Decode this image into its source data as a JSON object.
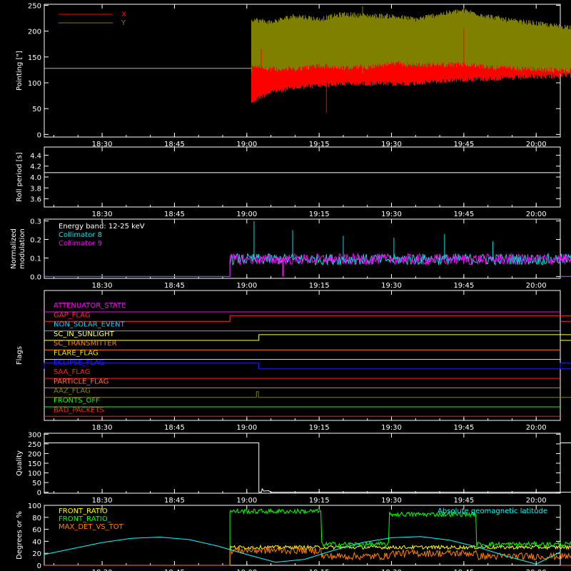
{
  "x_axis": {
    "tick_labels": [
      "18:30",
      "18:45",
      "19:00",
      "19:15",
      "19:30",
      "19:45",
      "20:00"
    ],
    "tick_minutes": [
      1110,
      1125,
      1140,
      1155,
      1170,
      1185,
      1200
    ],
    "range_minutes": [
      1098,
      1205
    ]
  },
  "chart_data": [
    {
      "type": "line",
      "id": "pointing",
      "ylabel": "Pointing [\"]",
      "ylim": [
        -5,
        252
      ],
      "yticks": [
        0,
        50,
        100,
        150,
        200,
        250
      ],
      "legend": [
        {
          "name": "X",
          "color": "#ff0000"
        },
        {
          "name": "Y",
          "color": "#808000"
        }
      ],
      "reference_line": {
        "y": 128,
        "color": "#b0b0b0"
      },
      "series": [
        {
          "name": "X",
          "color": "#ff0000",
          "x": [
            1141,
            1145,
            1150,
            1155,
            1160,
            1165,
            1170,
            1175,
            1180,
            1185,
            1190,
            1195,
            1200,
            1203,
            1207,
            1212,
            1217,
            1222,
            1227,
            1232,
            1237,
            1242
          ],
          "y_low": [
            68,
            88,
            95,
            100,
            103,
            104,
            103,
            104,
            108,
            112,
            113,
            114,
            117,
            118,
            119,
            120,
            121,
            121,
            122,
            122,
            122,
            122
          ],
          "y_high": [
            140,
            132,
            132,
            138,
            134,
            136,
            142,
            140,
            140,
            140,
            136,
            133,
            131,
            130,
            129,
            128,
            128,
            127,
            127,
            126,
            126,
            126
          ]
        },
        {
          "name": "Y",
          "color": "#808000",
          "x": [
            1141,
            1145,
            1150,
            1155,
            1160,
            1165,
            1170,
            1175,
            1180,
            1185,
            1190,
            1195,
            1200,
            1203,
            1207,
            1212,
            1217,
            1222,
            1227,
            1232,
            1237,
            1242
          ],
          "y_low": [
            140,
            132,
            132,
            138,
            134,
            136,
            142,
            140,
            140,
            140,
            136,
            133,
            131,
            130,
            129,
            128,
            128,
            127,
            127,
            126,
            126,
            126
          ],
          "y_high": [
            218,
            212,
            225,
            218,
            228,
            225,
            224,
            218,
            228,
            235,
            224,
            215,
            210,
            206,
            203,
            200,
            198,
            197,
            196,
            195,
            195,
            194
          ]
        }
      ],
      "spikes": [
        {
          "x": 1141.0,
          "y0": 120,
          "y1": 222,
          "color": "#808000"
        },
        {
          "x": 1143.0,
          "y0": 112,
          "y1": 165,
          "color": "#ff0000"
        },
        {
          "x": 1156.5,
          "y0": 42,
          "y1": 138,
          "color": "#ff0000"
        },
        {
          "x": 1164.0,
          "y0": 118,
          "y1": 248,
          "color": "#808000"
        },
        {
          "x": 1185.0,
          "y0": 128,
          "y1": 205,
          "color": "#ff0000"
        }
      ]
    },
    {
      "type": "line",
      "id": "roll",
      "ylabel": "Roll period [s]",
      "ylim": [
        3.45,
        4.55
      ],
      "yticks": [
        3.6,
        3.8,
        4.0,
        4.2,
        4.4
      ],
      "tick_labels": [
        "3.6",
        "3.8",
        "4.0",
        "4.2",
        "4.4"
      ],
      "series": [
        {
          "name": "",
          "color": "#ffffff",
          "x": [
            1098,
            1205
          ],
          "y": [
            4.08,
            4.08
          ]
        }
      ]
    },
    {
      "type": "line",
      "id": "modulation",
      "ylabel": "Normalized modulation",
      "ylim": [
        -0.01,
        0.31
      ],
      "yticks": [
        0.0,
        0.1,
        0.2,
        0.3
      ],
      "tick_labels": [
        "0.0",
        "0.1",
        "0.2",
        "0.3"
      ],
      "legend": [
        {
          "name": "Energy band: 12-25 keV",
          "color": "#ffffff"
        },
        {
          "name": "Collimator 8",
          "color": "#00e0e0"
        },
        {
          "name": "Collimator 9",
          "color": "#ff00ff"
        }
      ],
      "series": [
        {
          "name": "Collimator 8",
          "color": "#00e0e0",
          "x_range": [
            1136.5,
            1243.5
          ],
          "baseline": 0.09,
          "spread": 0.03
        },
        {
          "name": "Collimator 9",
          "color": "#ff00ff",
          "x_range": [
            1136.5,
            1243.5
          ],
          "baseline": 0.09,
          "spread": 0.03,
          "outside_value": 0.0,
          "dips": [
            {
              "x": 1147.5,
              "y": 0.0
            }
          ]
        }
      ],
      "peaks": [
        {
          "x": 1141.5,
          "y": 0.3,
          "color": "#00e0e0"
        },
        {
          "x": 1149.5,
          "y": 0.25,
          "color": "#00e0e0"
        },
        {
          "x": 1160.0,
          "y": 0.22,
          "color": "#00e0e0"
        },
        {
          "x": 1170.5,
          "y": 0.21,
          "color": "#00e0e0"
        },
        {
          "x": 1181.0,
          "y": 0.23,
          "color": "#00e0e0"
        },
        {
          "x": 1191.0,
          "y": 0.19,
          "color": "#00e0e0"
        }
      ]
    },
    {
      "type": "line",
      "id": "flags",
      "ylabel": "Flags",
      "flags": [
        {
          "name": "ATTENUATOR_STATE",
          "color": "#ff00ff",
          "steps": []
        },
        {
          "name": "GAP_FLAG",
          "color": "#ff2a2a",
          "steps": [
            {
              "from": 1136.5,
              "to": 1243.5
            }
          ]
        },
        {
          "name": "NON_SOLAR_EVENT",
          "color": "#00d0ff",
          "steps": []
        },
        {
          "name": "SC_IN_SUNLIGHT",
          "color": "#ffff60",
          "steps": [
            {
              "from": 1098,
              "to": 1242.5,
              "raised": false
            },
            {
              "from": 1142.5,
              "to": 1242.5
            }
          ]
        },
        {
          "name": "SC_TRANSMITTER",
          "color": "#ff8000",
          "steps": []
        },
        {
          "name": "FLARE_FLAG",
          "color": "#e8e800",
          "steps": []
        },
        {
          "name": "ECLIPSE_FLAG",
          "color": "#2020ff",
          "steps": [
            {
              "from": 1098,
              "to": 1142.5
            },
            {
              "from": 1242.5,
              "to": 1205
            }
          ]
        },
        {
          "name": "SAA_FLAG",
          "color": "#ff2020",
          "steps": []
        },
        {
          "name": "PARTICLE_FLAG",
          "color": "#ff7030",
          "steps": []
        },
        {
          "name": "AAZ_FLAG",
          "color": "#808000",
          "steps": [
            {
              "from": 1142.0,
              "to": 1142.4
            },
            {
              "from": 1241.7,
              "to": 1242.1
            }
          ]
        },
        {
          "name": "FRONTS_OFF",
          "color": "#00ff00",
          "steps": []
        },
        {
          "name": "BAD_PACKETS",
          "color": "#ff2020",
          "steps": []
        }
      ]
    },
    {
      "type": "line",
      "id": "quality",
      "ylabel": "Quality",
      "ylim": [
        -5,
        305
      ],
      "yticks": [
        0,
        50,
        100,
        150,
        200,
        250,
        300
      ],
      "series": [
        {
          "name": "",
          "color": "#ffffff",
          "x": [
            1098,
            1142.5,
            1142.5,
            1143.0,
            1143.2,
            1143.5,
            1144.5,
            1145.0,
            1242.0,
            1242.0,
            1205
          ],
          "y": [
            255,
            255,
            0,
            0,
            18,
            6,
            8,
            0,
            0,
            255,
            255
          ]
        }
      ]
    },
    {
      "type": "line",
      "id": "ratio",
      "ylabel": "Degrees or %",
      "ylim": [
        0,
        100
      ],
      "yticks": [
        0,
        20,
        40,
        60,
        80,
        100
      ],
      "legend": [
        {
          "name": "FRONT_RATIO",
          "color": "#ffff00"
        },
        {
          "name": "FRONT_RATIO_",
          "color": "#00ff00"
        },
        {
          "name": "MAX_DET_VS_TOT",
          "color": "#ff8000"
        }
      ],
      "annotation": {
        "text": "Absolute geomagnetic latitude",
        "color": "#00ffff"
      },
      "series": [
        {
          "name": "FRONT_RATIO",
          "color": "#ffff00",
          "x_range": [
            1136.5,
            1243.5
          ],
          "baseline": 30,
          "spread": 3
        },
        {
          "name": "FRONT_RATIO_",
          "color": "#00ff00",
          "x_range": [
            1136.5,
            1243.5
          ],
          "segments": [
            {
              "from": 1136.5,
              "to": 1155.5,
              "baseline": 90
            },
            {
              "from": 1155.5,
              "to": 1169.5,
              "baseline": 35
            },
            {
              "from": 1169.5,
              "to": 1187.5,
              "baseline": 85
            },
            {
              "from": 1187.5,
              "to": 1243.5,
              "baseline": 35
            }
          ],
          "spread": 4
        },
        {
          "name": "MAX_DET_VS_TOT",
          "color": "#ff8000",
          "x_range": [
            1136.5,
            1243.5
          ],
          "segments": [
            {
              "from": 1136.5,
              "to": 1155.5,
              "baseline": 25
            },
            {
              "from": 1155.5,
              "to": 1169.5,
              "baseline": 15
            },
            {
              "from": 1169.5,
              "to": 1187.5,
              "baseline": 20
            },
            {
              "from": 1187.5,
              "to": 1243.5,
              "baseline": 15
            }
          ],
          "spread": 6
        },
        {
          "name": "Absolute geomagnetic latitude",
          "color": "#00ffff",
          "x": [
            1098,
            1104,
            1110,
            1116,
            1122,
            1128,
            1134,
            1140,
            1146,
            1152,
            1158,
            1164,
            1170,
            1176,
            1182,
            1188,
            1194,
            1200,
            1205
          ],
          "y": [
            18,
            28,
            38,
            45,
            47,
            43,
            32,
            18,
            5,
            10,
            25,
            38,
            46,
            48,
            42,
            30,
            15,
            2,
            22
          ]
        }
      ]
    }
  ]
}
